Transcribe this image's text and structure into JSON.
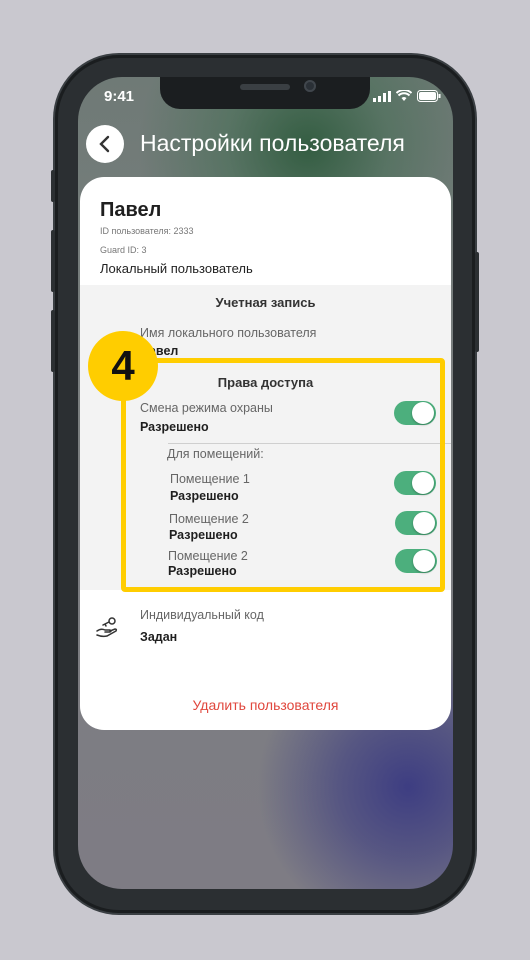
{
  "status_bar": {
    "time": "9:41",
    "icons": [
      "signal-icon",
      "wifi-icon",
      "battery-icon"
    ]
  },
  "header": {
    "back_icon": "chevron-left-icon",
    "title": "Настройки пользователя"
  },
  "user": {
    "name": "Павел",
    "id_line": "ID пользователя: 2333",
    "guard_line": "Guard ID: 3",
    "type": "Локальный пользователь"
  },
  "account": {
    "title": "Учетная запись",
    "local_name_label": "Имя локального пользователя",
    "local_name_value": "Павел"
  },
  "access": {
    "title": "Права доступа",
    "mode_label": "Смена режима охраны",
    "mode_value": "Разрешено",
    "rooms_header": "Для помещений:",
    "rooms": [
      {
        "label": "Помещение 1",
        "value": "Разрешено"
      },
      {
        "label": "Помещение 2",
        "value": "Разрешено"
      },
      {
        "label": "Помещение 2",
        "value": "Разрешено"
      }
    ]
  },
  "code": {
    "icon": "hand-key-icon",
    "label": "Индивидуальный код",
    "value": "Задан"
  },
  "delete_label": "Удалить пользователя",
  "annotation": {
    "number": "4",
    "color": "#ffcd00"
  },
  "colors": {
    "toggle_on": "#4caf7d",
    "delete": "#e0473d"
  }
}
